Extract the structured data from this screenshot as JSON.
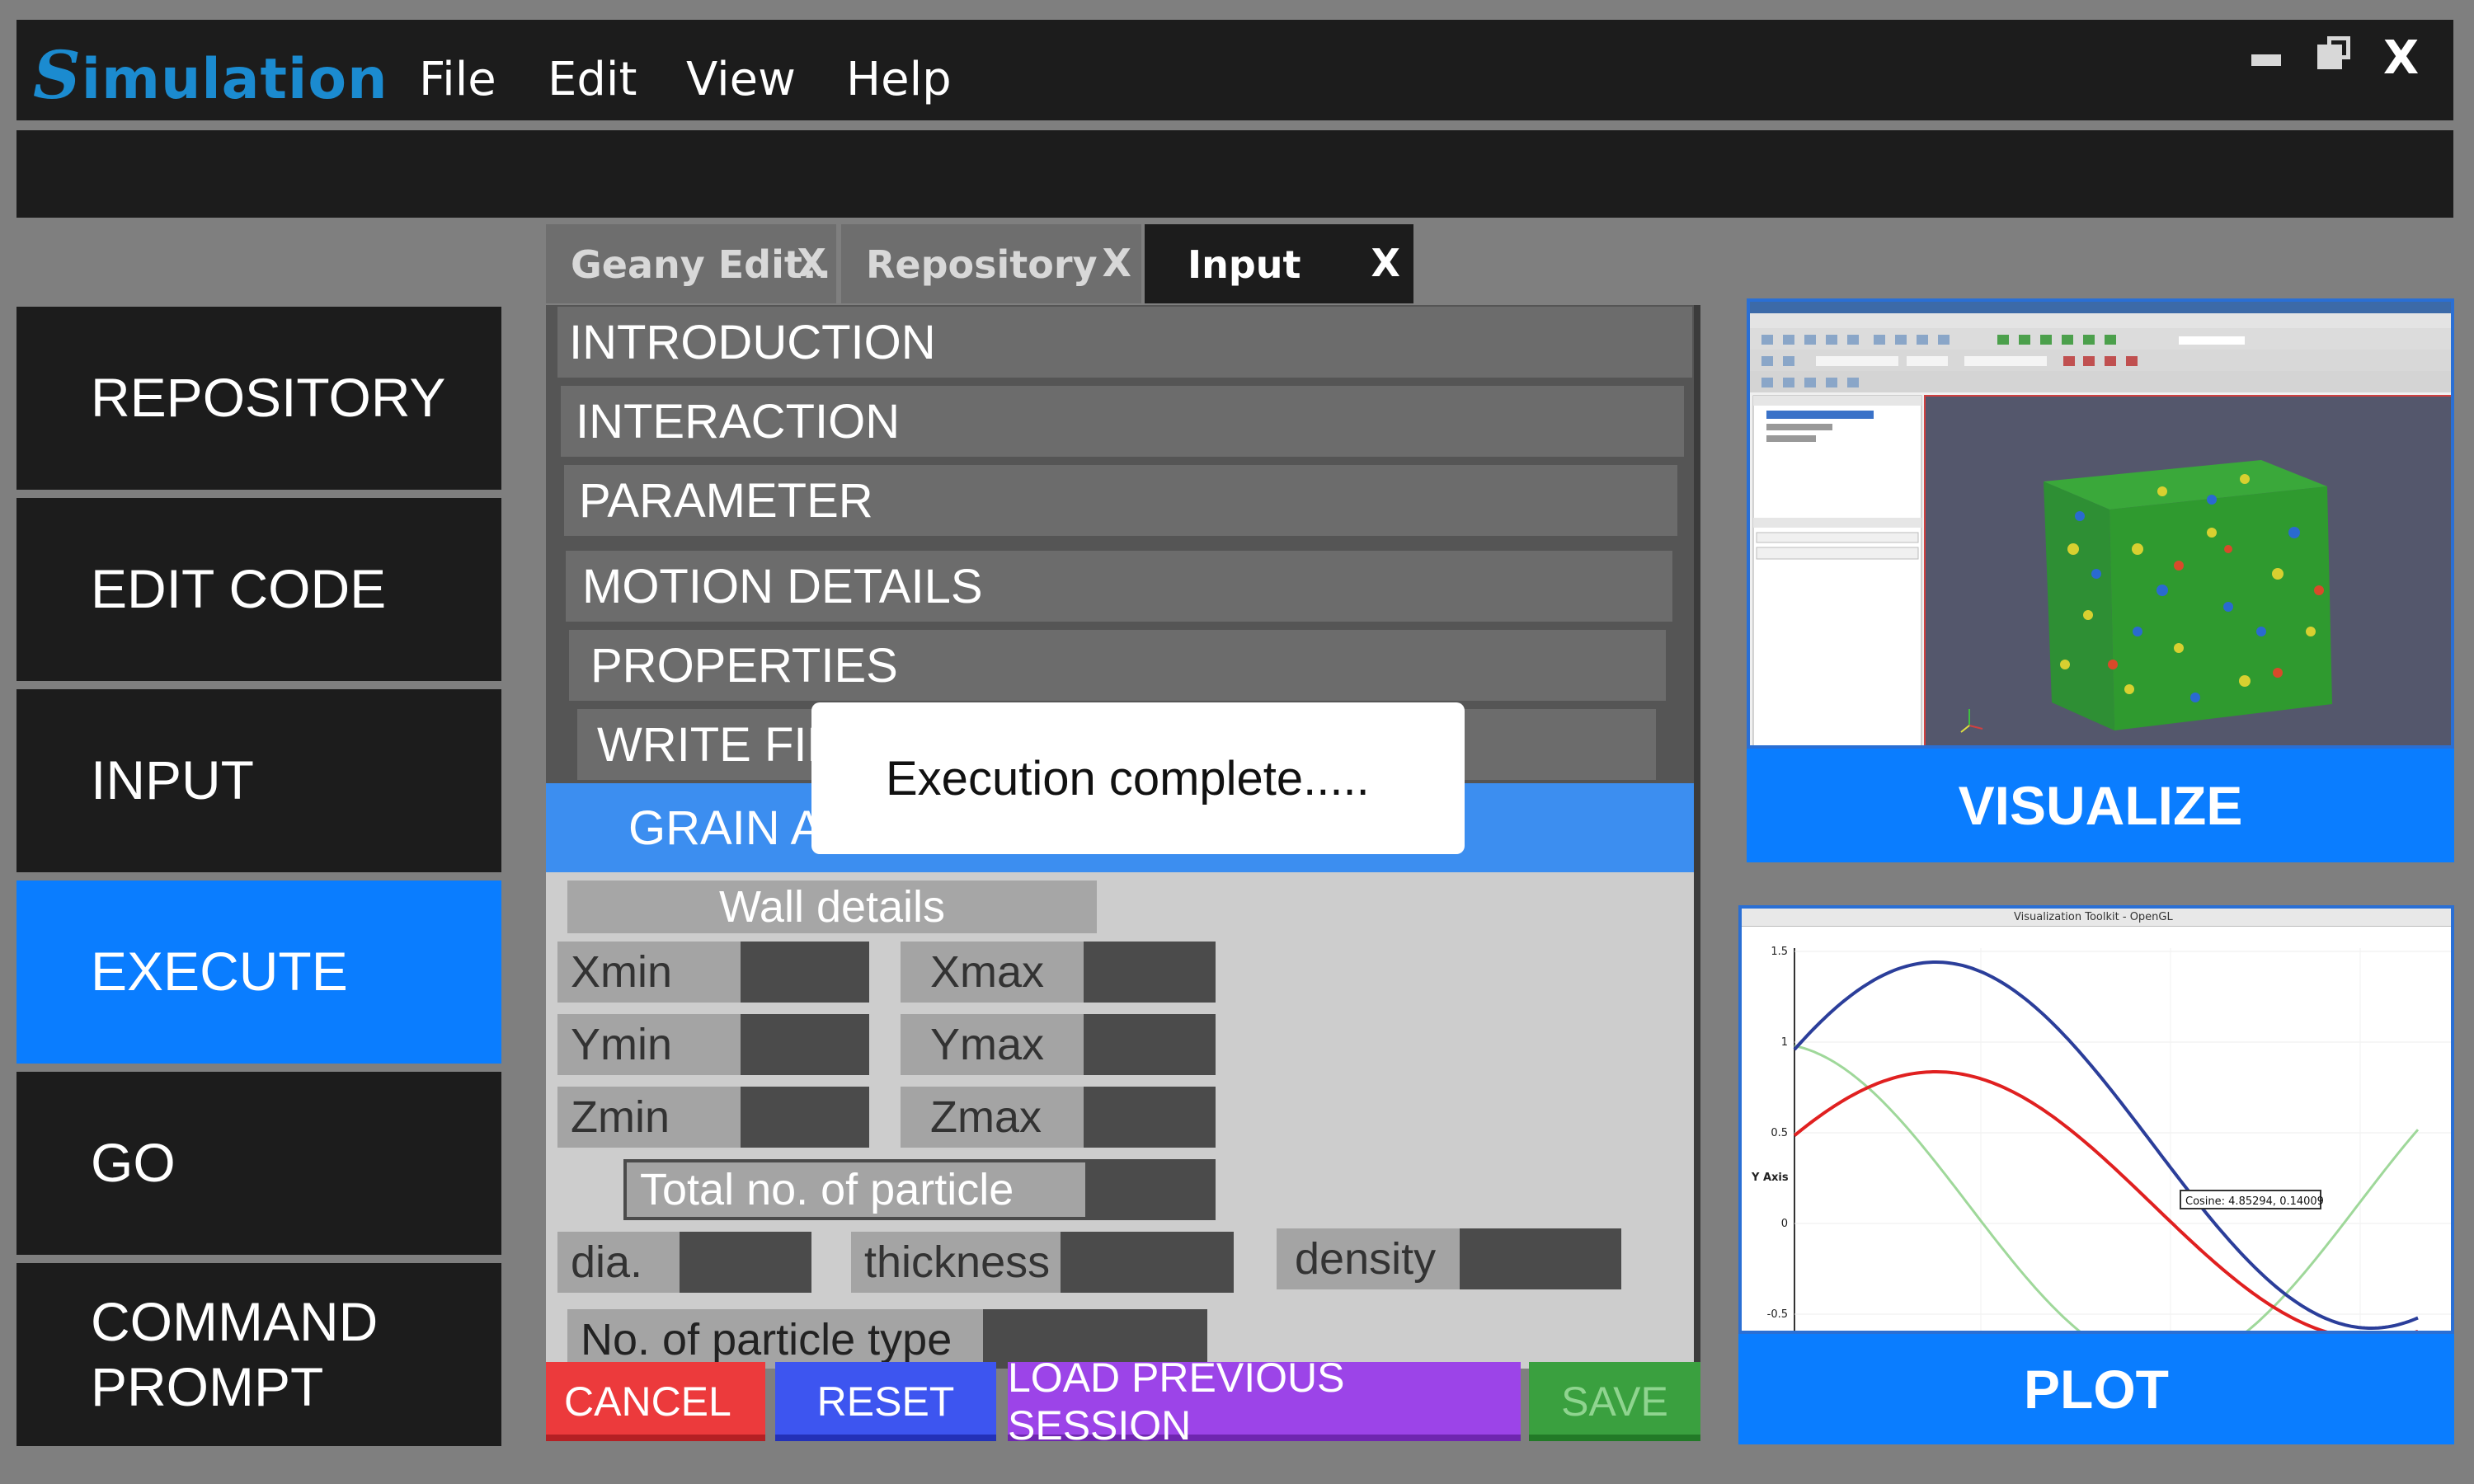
{
  "app": {
    "logo_initial": "S",
    "logo_rest": "imulation",
    "menu": [
      "File",
      "Edit",
      "View",
      "Help"
    ],
    "close_label": "X"
  },
  "sidebar": {
    "items": [
      {
        "label": "REPOSITORY"
      },
      {
        "label": "EDIT CODE"
      },
      {
        "label": "INPUT"
      },
      {
        "label": "EXECUTE",
        "active": true
      },
      {
        "label": "GO"
      },
      {
        "label": "COMMAND PROMPT"
      }
    ]
  },
  "tabs": [
    {
      "label": "Geany Edit..",
      "close": "X"
    },
    {
      "label": "Repository",
      "close": "X"
    },
    {
      "label": "Input",
      "close": "X",
      "active": true
    }
  ],
  "sections": [
    "INTRODUCTION",
    "INTERACTION",
    "PARAMETER",
    "MOTION DETAILS",
    "PROPERTIES",
    "WRITE FILE",
    "GRAIN ADDITION"
  ],
  "form": {
    "wall_details": "Wall details",
    "xmin": "Xmin",
    "xmax": "Xmax",
    "ymin": "Ymin",
    "ymax": "Ymax",
    "zmin": "Zmin",
    "zmax": "Zmax",
    "total_particles": "Total no. of particle",
    "dia": "dia.",
    "thickness": "thickness",
    "density": "density",
    "particle_types": "No. of particle type"
  },
  "buttons": {
    "cancel": "CANCEL",
    "reset": "RESET",
    "load": "LOAD PREVIOUS SESSION",
    "save": "SAVE"
  },
  "modal": {
    "message": "Execution complete....."
  },
  "right": {
    "visualize": "VISUALIZE",
    "plot": "PLOT",
    "plot_window_title": "Visualization Toolkit - OpenGL",
    "plot_tooltip": "Cosine: 4.85294, 0.14009",
    "plot_ylabel": "Y Axis",
    "plot_ticks": [
      "1.5",
      "1",
      "0.5",
      "0",
      "-0.5"
    ]
  },
  "colors": {
    "accent": "#0a7dff",
    "logo": "#1b8bd0",
    "cancel": "#ec3a3c",
    "reset": "#3d55f0",
    "load": "#9c44e8",
    "save": "#3aa03f"
  }
}
